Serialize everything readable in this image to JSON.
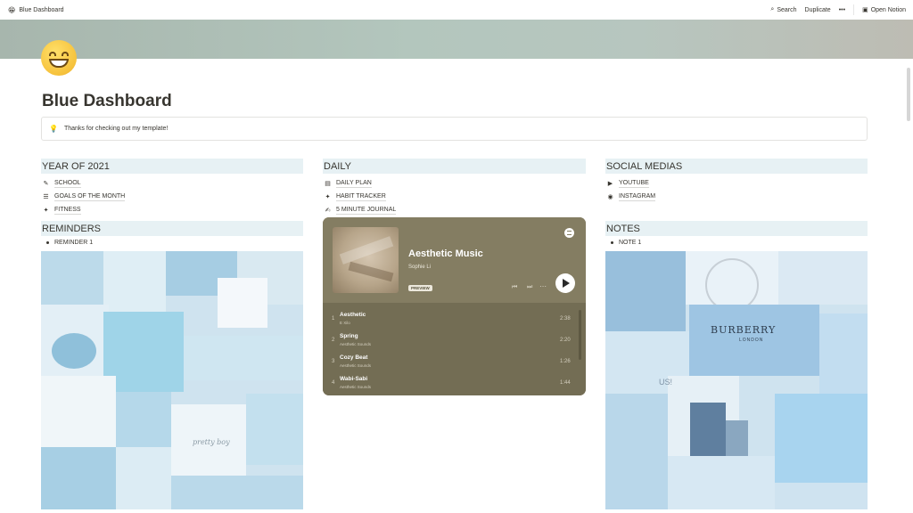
{
  "topbar": {
    "page_title": "Blue Dashboard",
    "search": "Search",
    "duplicate": "Duplicate",
    "more": "•••",
    "open_notion": "Open Notion"
  },
  "page": {
    "title": "Blue Dashboard",
    "callout": "Thanks for checking out my template!"
  },
  "columns": {
    "year": {
      "heading": "YEAR OF 2021",
      "links": [
        {
          "icon": "✎",
          "label": "SCHOOL"
        },
        {
          "icon": "☰",
          "label": "GOALS OF THE MONTH"
        },
        {
          "icon": "✦",
          "label": "FITNESS"
        }
      ]
    },
    "daily": {
      "heading": "DAILY",
      "links": [
        {
          "icon": "▤",
          "label": "DAILY PLAN"
        },
        {
          "icon": "✦",
          "label": "HABIT TRACKER"
        },
        {
          "icon": "✍",
          "label": "5 MINUTE JOURNAL"
        }
      ]
    },
    "social": {
      "heading": "SOCIAL MEDIAS",
      "links": [
        {
          "icon": "▶",
          "label": "YOUTUBE"
        },
        {
          "icon": "◉",
          "label": "INSTAGRAM"
        }
      ]
    },
    "reminders": {
      "heading": "REMINDERS",
      "items": [
        "REMINDER 1"
      ]
    },
    "notes": {
      "heading": "NOTES",
      "items": [
        "NOTE 1"
      ]
    }
  },
  "player": {
    "title": "Aesthetic Music",
    "artist": "Sophie Li",
    "badge": "PREVIEW",
    "tracks": [
      {
        "num": "1",
        "name": "Aesthetic",
        "sub": "E  Xilo",
        "dur": "2:38"
      },
      {
        "num": "2",
        "name": "Spring",
        "sub": "Aesthetic Sounds",
        "dur": "2:20"
      },
      {
        "num": "3",
        "name": "Cozy Beat",
        "sub": "Aesthetic Sounds",
        "dur": "1:26"
      },
      {
        "num": "4",
        "name": "Wabi-Sabi",
        "sub": "Aesthetic Sounds",
        "dur": "1:44"
      }
    ]
  },
  "collage_left_text": {
    "pretty_boy": "pretty boy"
  },
  "collage_right_text": {
    "burberry": "BURBERRY",
    "london": "LONDON",
    "us": "US!"
  },
  "colors": {
    "heading_bg": "#e7f1f4",
    "player_bg": "#847d62",
    "accent_blue": "#a9cfe6"
  }
}
